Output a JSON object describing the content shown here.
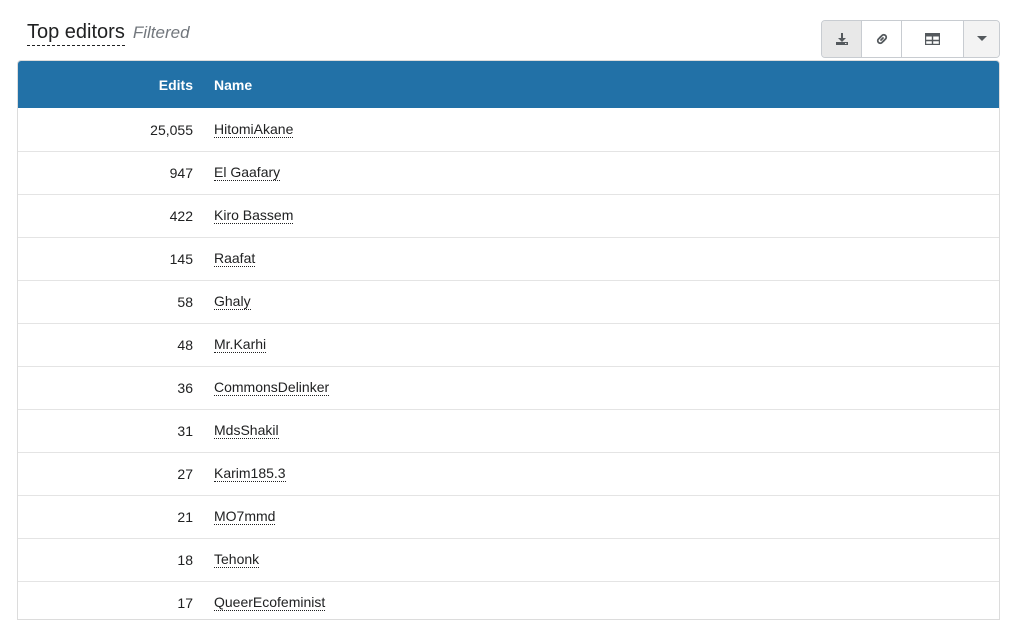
{
  "header": {
    "title": "Top editors",
    "subtitle": "Filtered"
  },
  "toolbar": {
    "buttons": [
      {
        "icon": "download-icon"
      },
      {
        "icon": "link-icon"
      },
      {
        "icon": "table-icon"
      },
      {
        "icon": "caret-down-icon"
      }
    ]
  },
  "table": {
    "columns": [
      "Edits",
      "Name"
    ],
    "rows": [
      {
        "edits": "25,055",
        "name": "HitomiAkane"
      },
      {
        "edits": "947",
        "name": "El Gaafary"
      },
      {
        "edits": "422",
        "name": "Kiro Bassem"
      },
      {
        "edits": "145",
        "name": "Raafat"
      },
      {
        "edits": "58",
        "name": "Ghaly"
      },
      {
        "edits": "48",
        "name": "Mr.Karhi"
      },
      {
        "edits": "36",
        "name": "CommonsDelinker"
      },
      {
        "edits": "31",
        "name": "MdsShakil"
      },
      {
        "edits": "27",
        "name": "Karim185.3"
      },
      {
        "edits": "21",
        "name": "MO7mmd"
      },
      {
        "edits": "18",
        "name": "Tehonk"
      },
      {
        "edits": "17",
        "name": "QueerEcofeminist"
      }
    ]
  },
  "colors": {
    "header_bg": "#2271a7",
    "text": "#202122",
    "muted": "#72777d"
  }
}
